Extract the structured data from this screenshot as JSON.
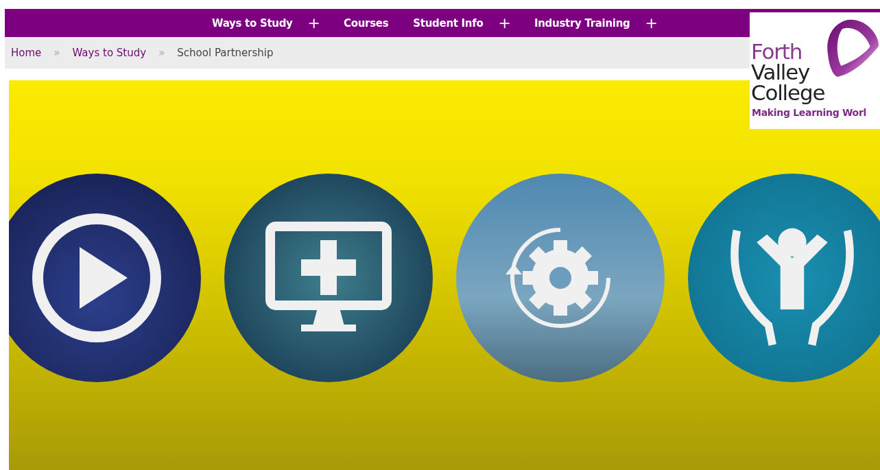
{
  "nav": {
    "items": [
      {
        "label": "Ways to Study",
        "expandable": true
      },
      {
        "label": "Courses",
        "expandable": false
      },
      {
        "label": "Student Info",
        "expandable": true
      },
      {
        "label": "Industry Training",
        "expandable": true
      }
    ],
    "expand_symbol": "+"
  },
  "breadcrumb": {
    "items": [
      {
        "label": "Home",
        "link": true
      },
      {
        "label": "Ways to Study",
        "link": true
      },
      {
        "label": "School Partnership",
        "link": false
      }
    ],
    "separator": "»"
  },
  "logo": {
    "lines": [
      "Forth",
      "Valley",
      "College"
    ],
    "tagline": "Making Learning Worl"
  },
  "hero": {
    "tiles": [
      {
        "kind": "play"
      },
      {
        "kind": "monitor"
      },
      {
        "kind": "gear"
      },
      {
        "kind": "hands"
      }
    ]
  }
}
